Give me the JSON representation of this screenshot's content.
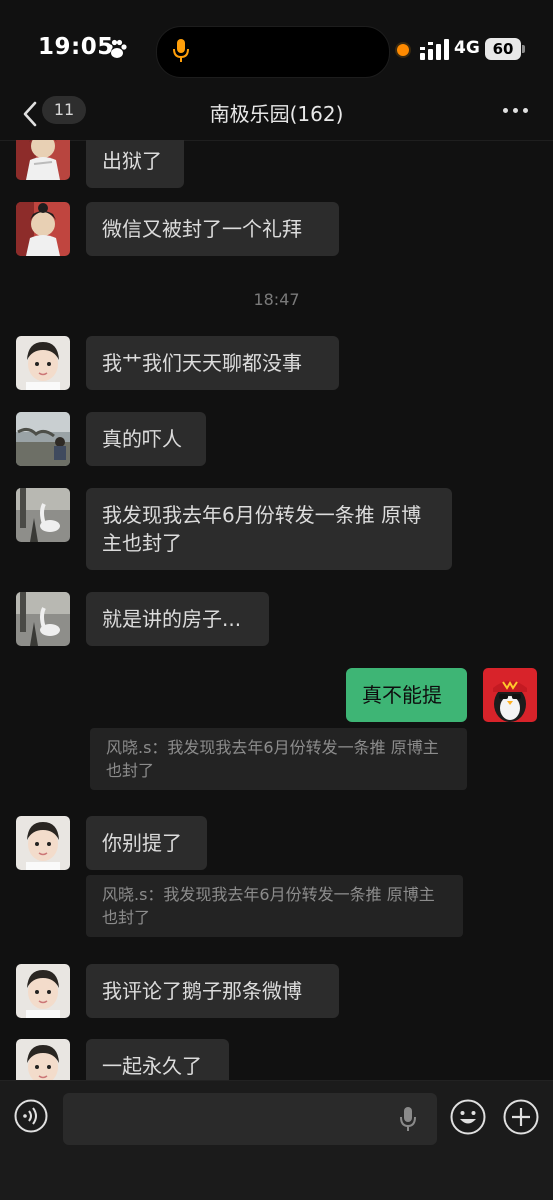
{
  "status_bar": {
    "time": "19:05",
    "network": "4G",
    "battery": "60",
    "icons": [
      "paw-icon",
      "microphone-indicator-icon",
      "recording-dot-icon",
      "cellular-signal-icon",
      "battery-icon"
    ],
    "colors": {
      "recording_dot": "#ff8a00",
      "mic_indicator": "#ff9f0a"
    }
  },
  "nav": {
    "unread_count": "11",
    "title": "南极乐园(162)",
    "icons": [
      "back-chevron-icon",
      "more-dots-icon"
    ]
  },
  "chat": {
    "messages": [
      {
        "side": "left",
        "text": "出狱了",
        "avatar": "anime-character-avatar"
      },
      {
        "side": "left",
        "text": "微信又被封了一个礼拜",
        "avatar": "anime-character-avatar"
      },
      {
        "side": "left",
        "text": "我艹我们天天聊都没事",
        "avatar": "child-photo-avatar"
      },
      {
        "side": "left",
        "text": "真的吓人",
        "avatar": "outdoor-photo-avatar"
      },
      {
        "side": "left",
        "text": "我发现我去年6月份转发一条推 原博主也封了",
        "avatar": "goose-photo-avatar"
      },
      {
        "side": "left",
        "text": "就是讲的房子...",
        "avatar": "goose-photo-avatar"
      },
      {
        "side": "right",
        "text": "真不能提",
        "avatar": "penguin-cartoon-avatar"
      },
      {
        "side": "left",
        "text": "你别提了",
        "avatar": "child-photo-avatar"
      },
      {
        "side": "left",
        "text": "我评论了鹅子那条微博",
        "avatar": "child-photo-avatar"
      },
      {
        "side": "left",
        "text": "一起永久了",
        "avatar": "child-photo-avatar"
      }
    ],
    "timestamp": "18:47",
    "quote_1": "风晓.s：我发现我去年6月份转发一条推 原博主也封了",
    "quote_2": "风晓.s：我发现我去年6月份转发一条推 原博主也封了"
  },
  "input_bar": {
    "icons": [
      "voice-input-icon",
      "microphone-icon",
      "emoji-icon",
      "plus-icon"
    ]
  },
  "colors": {
    "background": "#111111",
    "bubble_incoming": "#2c2c2c",
    "bubble_outgoing": "#3eb575",
    "quote_bg": "#232323",
    "input_bar_bg": "#1b1b1b"
  }
}
